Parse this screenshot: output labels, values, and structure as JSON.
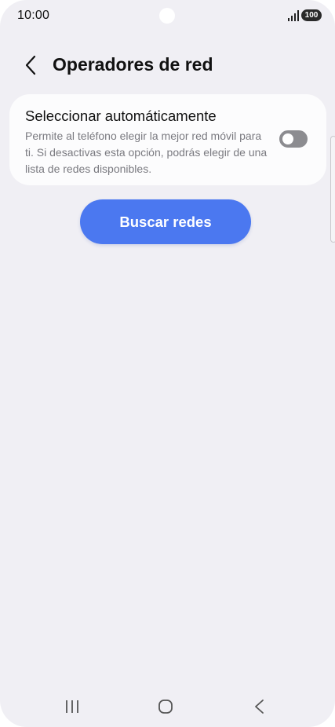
{
  "status_bar": {
    "time": "10:00",
    "battery": "100",
    "signal_icon": "signal-icon"
  },
  "header": {
    "back_icon": "chevron-left-icon",
    "title": "Operadores de red"
  },
  "auto_select": {
    "title": "Seleccionar automáticamente",
    "description": "Permite al teléfono elegir la mejor red móvil para ti. Si desactivas esta opción, podrás elegir de una lista de redes disponibles.",
    "toggle_on": false
  },
  "search_button": {
    "label": "Buscar redes"
  },
  "colors": {
    "background": "#f0eff4",
    "card": "#fcfcfd",
    "accent": "#4b78f0",
    "toggle_off": "#8c8c90"
  },
  "nav_bar": {
    "recents_icon": "recents-icon",
    "home_icon": "home-icon",
    "back_icon": "back-icon"
  }
}
